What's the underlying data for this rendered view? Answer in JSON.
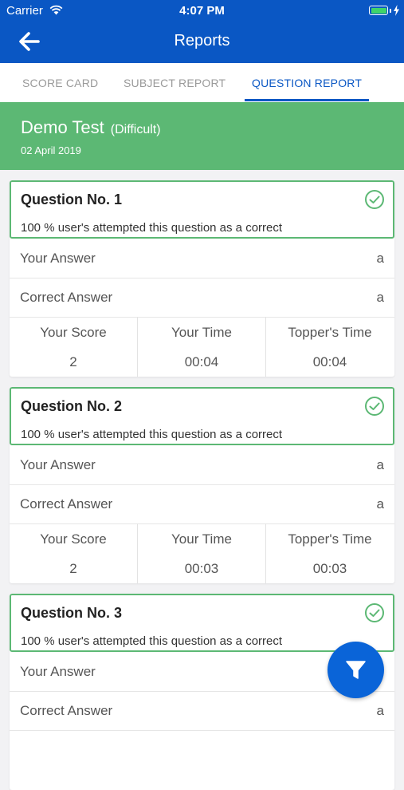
{
  "status_bar": {
    "carrier": "Carrier",
    "time": "4:07 PM",
    "battery_level": 1.0,
    "icons": [
      "wifi-icon",
      "battery-icon",
      "charging-bolt-icon"
    ]
  },
  "nav": {
    "title": "Reports",
    "back_icon": "arrow-left-icon"
  },
  "tabs": [
    {
      "label": "SCORE CARD",
      "active": false
    },
    {
      "label": "SUBJECT REPORT",
      "active": false
    },
    {
      "label": "QUESTION REPORT",
      "active": true
    }
  ],
  "test": {
    "name": "Demo Test",
    "level": "(Difficult)",
    "date": "02 April 2019"
  },
  "labels": {
    "your_answer": "Your Answer",
    "correct_answer": "Correct Answer",
    "your_score": "Your Score",
    "your_time": "Your Time",
    "toppers_time": "Topper's Time"
  },
  "questions": [
    {
      "title": "Question No. 1",
      "stat": "100 % user's attempted this question as a correct",
      "your_answer": "a",
      "correct_answer": "a",
      "score": "2",
      "your_time": "00:04",
      "toppers_time": "00:04"
    },
    {
      "title": "Question No. 2",
      "stat": "100 % user's attempted this question as a correct",
      "your_answer": "a",
      "correct_answer": "a",
      "score": "2",
      "your_time": "00:03",
      "toppers_time": "00:03"
    },
    {
      "title": "Question No. 3",
      "stat": "100 % user's attempted this question as a correct",
      "your_answer": "",
      "correct_answer": "a"
    }
  ],
  "colors": {
    "primary": "#0a57c4",
    "success": "#5cb874",
    "fab": "#0a64d8"
  },
  "fab_icon": "filter-icon"
}
